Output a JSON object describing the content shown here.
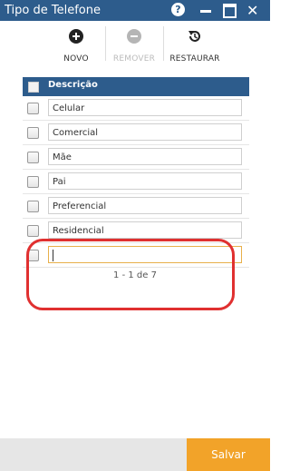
{
  "window": {
    "title": "Tipo de Telefone",
    "help_glyph": "?",
    "close_glyph": "✕"
  },
  "toolbar": {
    "novo": {
      "label": "NOVO",
      "icon": "plus-circle-icon"
    },
    "remover": {
      "label": "REMOVER",
      "icon": "minus-circle-icon",
      "enabled": false
    },
    "restaurar": {
      "label": "RESTAURAR",
      "icon": "restore-icon"
    }
  },
  "table": {
    "header": "Descrição",
    "rows": [
      "Celular",
      "Comercial",
      "Mãe",
      "Pai",
      "Preferencial",
      "Residencial"
    ],
    "new_row_value": ""
  },
  "pager": {
    "text": "1 - 1 de 7"
  },
  "footer": {
    "save_label": "Salvar"
  },
  "colors": {
    "titlebar": "#2d5c8c",
    "save": "#f2a329",
    "highlight": "#e03030"
  }
}
